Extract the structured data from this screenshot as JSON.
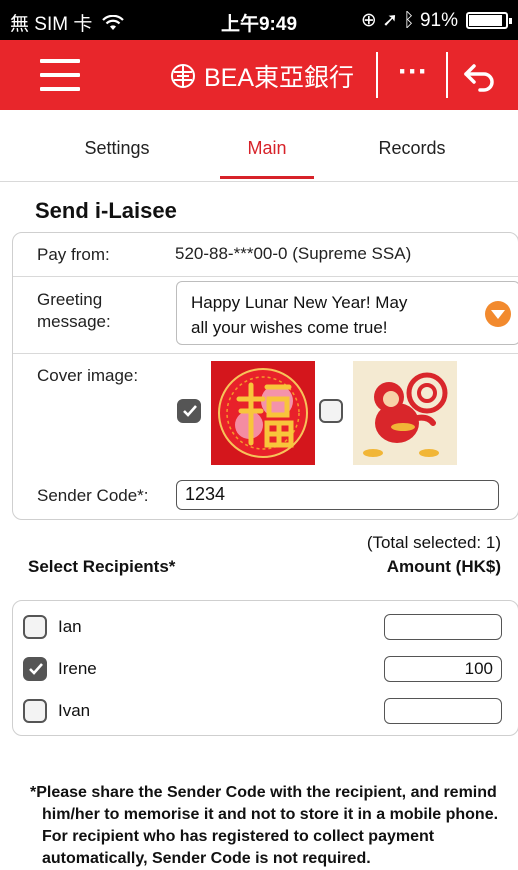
{
  "status_bar": {
    "carrier": "無 SIM 卡",
    "time": "上午9:49",
    "battery": "91%",
    "battery_level": 0.91
  },
  "nav": {
    "brand": "BEA東亞銀行",
    "more_label": "···"
  },
  "tabs": [
    {
      "label": "Settings",
      "active": false
    },
    {
      "label": "Main",
      "active": true
    },
    {
      "label": "Records",
      "active": false
    }
  ],
  "page": {
    "title": "Send i-Laisee"
  },
  "form": {
    "pay_from_label": "Pay from:",
    "pay_from_value": "520-88-***00-0 (Supreme SSA)",
    "greeting_label_line1": "Greeting",
    "greeting_label_line2": "message:",
    "greeting_line1": "Happy Lunar New Year! May",
    "greeting_line2": "all your wishes come true!",
    "cover_label": "Cover image:",
    "covers": [
      {
        "name": "fu-character",
        "checked": true
      },
      {
        "name": "monkey",
        "checked": false
      }
    ],
    "sender_code_label": "Sender Code*:",
    "sender_code_value": "1234"
  },
  "recipients": {
    "total_selected": "(Total selected: 1)",
    "select_label": "Select Recipients*",
    "amount_label": "Amount (HK$)",
    "items": [
      {
        "name": "Ian",
        "checked": false,
        "amount": ""
      },
      {
        "name": "Irene",
        "checked": true,
        "amount": "100"
      },
      {
        "name": "Ivan",
        "checked": false,
        "amount": ""
      }
    ]
  },
  "note": {
    "text": "*Please share the Sender Code with the recipient, and remind him/her to memorise it and not to store it in a mobile phone. For recipient who has registered to collect payment automatically, Sender Code is not required."
  },
  "colors": {
    "brand_red": "#e8262b",
    "active_tab": "#d72229",
    "dropdown": "#f28a2e"
  }
}
